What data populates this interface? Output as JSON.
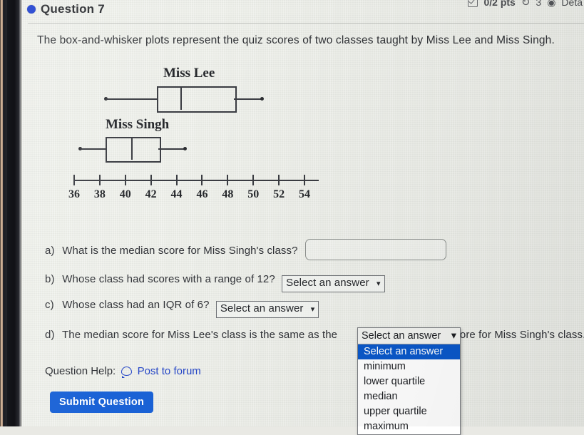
{
  "header": {
    "question_title": "Question 7",
    "points": "0/2 pts",
    "retry_icon": "retry-circular-arrow-icon",
    "retry_count": "3",
    "details_label": "Deta",
    "checkbox_icon": "checkbox-checked-icon"
  },
  "prompt": "The box-and-whisker plots represent the quiz scores of two classes taught by Miss Lee and Miss Singh.",
  "chart_data": {
    "type": "box",
    "title": "",
    "xlabel": "",
    "ylabel": "",
    "xlim": [
      35,
      55
    ],
    "ticks": [
      36,
      38,
      40,
      42,
      44,
      46,
      48,
      50,
      52,
      54
    ],
    "tick_labels": [
      "36",
      "38",
      "40",
      "42",
      "44",
      "46",
      "48",
      "50",
      "52",
      "54"
    ],
    "grid": false,
    "series": [
      {
        "name": "Miss Lee",
        "min": 38,
        "q1": 42,
        "median": 44,
        "q3": 48,
        "max": 50,
        "range": 12,
        "iqr": 6
      },
      {
        "name": "Miss Singh",
        "min": 36,
        "q1": 38,
        "median": 40,
        "q3": 42,
        "max": 44,
        "range": 8,
        "iqr": 4
      }
    ]
  },
  "questions": [
    {
      "letter": "a)",
      "text": "What is the median score for Miss Singh's class?",
      "input_type": "text",
      "value": "",
      "placeholder": ""
    },
    {
      "letter": "b)",
      "text": "Whose class had scores with a range of 12?",
      "input_type": "select",
      "value": "Select an answer"
    },
    {
      "letter": "c)",
      "text": "Whose class had an IQR of 6?",
      "input_type": "select",
      "value": "Select an answer"
    },
    {
      "letter": "d)",
      "text_before": "The median score for Miss Lee's class is the same as the",
      "text_after": "score for Miss Singh's class.",
      "input_type": "select-open",
      "value": "Select an answer"
    }
  ],
  "dropdown": {
    "selected": "Select an answer",
    "options": [
      "Select an answer",
      "minimum",
      "lower quartile",
      "median",
      "upper quartile",
      "maximum"
    ]
  },
  "footer": {
    "question_help_label": "Question Help:",
    "post_to_forum": "Post to forum",
    "forum_icon": "speech-bubble-icon",
    "submit_label": "Submit Question"
  },
  "colors": {
    "accent_blue": "#1a62d6",
    "link_blue": "#2546c7",
    "highlight_blue": "#0a58ca",
    "bullet_blue": "#1d3fd0",
    "plot_ink": "#3a3c42",
    "page_bg": "#eceee8"
  }
}
